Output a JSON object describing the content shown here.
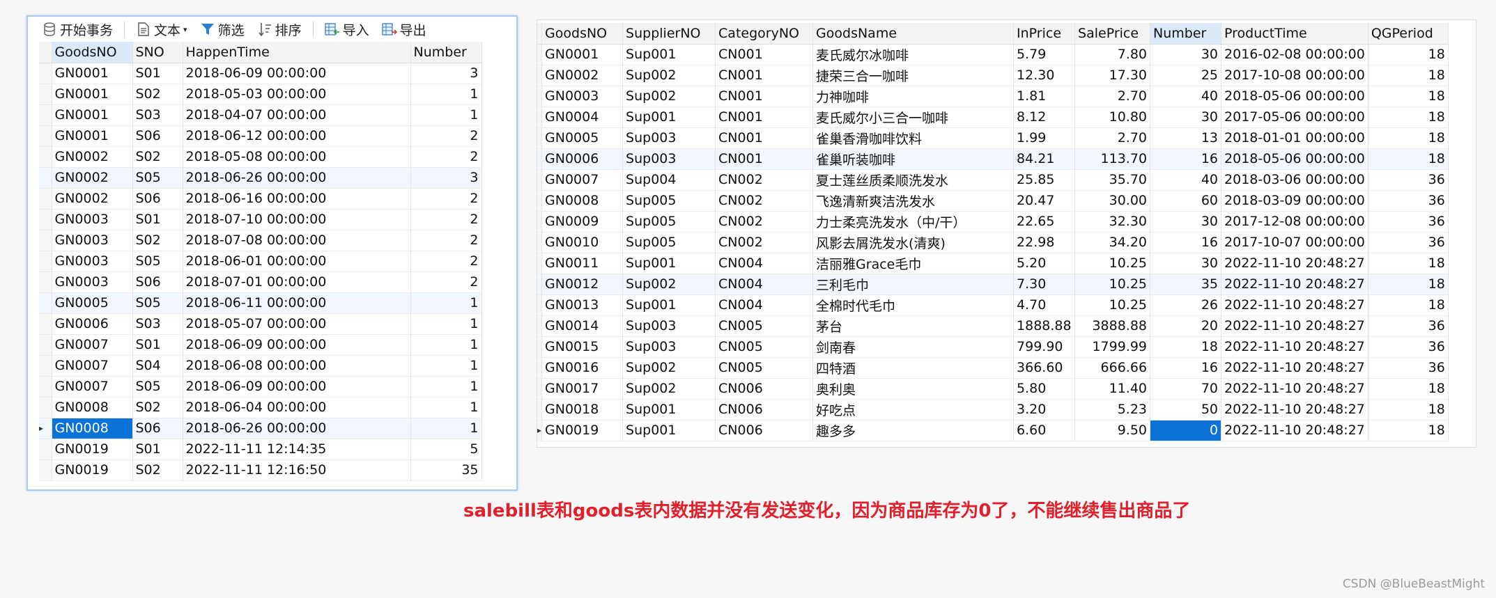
{
  "left_toolbar": {
    "begin_txn": "开始事务",
    "text": "文本",
    "filter": "筛选",
    "sort": "排序",
    "import": "导入",
    "export": "导出"
  },
  "salebill": {
    "columns": [
      "GoodsNO",
      "SNO",
      "HappenTime",
      "Number"
    ],
    "rows": [
      [
        "GN0001",
        "S01",
        "2018-06-09 00:00:00",
        "3"
      ],
      [
        "GN0001",
        "S02",
        "2018-05-03 00:00:00",
        "1"
      ],
      [
        "GN0001",
        "S03",
        "2018-04-07 00:00:00",
        "1"
      ],
      [
        "GN0001",
        "S06",
        "2018-06-12 00:00:00",
        "2"
      ],
      [
        "GN0002",
        "S02",
        "2018-05-08 00:00:00",
        "2"
      ],
      [
        "GN0002",
        "S05",
        "2018-06-26 00:00:00",
        "3"
      ],
      [
        "GN0002",
        "S06",
        "2018-06-16 00:00:00",
        "2"
      ],
      [
        "GN0003",
        "S01",
        "2018-07-10 00:00:00",
        "2"
      ],
      [
        "GN0003",
        "S02",
        "2018-07-08 00:00:00",
        "2"
      ],
      [
        "GN0003",
        "S05",
        "2018-06-01 00:00:00",
        "2"
      ],
      [
        "GN0003",
        "S06",
        "2018-07-01 00:00:00",
        "2"
      ],
      [
        "GN0005",
        "S05",
        "2018-06-11 00:00:00",
        "1"
      ],
      [
        "GN0006",
        "S03",
        "2018-05-07 00:00:00",
        "1"
      ],
      [
        "GN0007",
        "S01",
        "2018-06-09 00:00:00",
        "1"
      ],
      [
        "GN0007",
        "S04",
        "2018-06-08 00:00:00",
        "1"
      ],
      [
        "GN0007",
        "S05",
        "2018-06-09 00:00:00",
        "1"
      ],
      [
        "GN0008",
        "S02",
        "2018-06-04 00:00:00",
        "1"
      ],
      [
        "GN0008",
        "S06",
        "2018-06-26 00:00:00",
        "1"
      ],
      [
        "GN0019",
        "S01",
        "2022-11-11 12:14:35",
        "5"
      ],
      [
        "GN0019",
        "S02",
        "2022-11-11 12:16:50",
        "35"
      ]
    ]
  },
  "goods": {
    "columns": [
      "GoodsNO",
      "SupplierNO",
      "CategoryNO",
      "GoodsName",
      "InPrice",
      "SalePrice",
      "Number",
      "ProductTime",
      "QGPeriod"
    ],
    "rows": [
      [
        "GN0001",
        "Sup001",
        "CN001",
        "麦氏威尔冰咖啡",
        "5.79",
        "7.80",
        "30",
        "2016-02-08 00:00:00",
        "18"
      ],
      [
        "GN0002",
        "Sup002",
        "CN001",
        "捷荣三合一咖啡",
        "12.30",
        "17.30",
        "25",
        "2017-10-08 00:00:00",
        "18"
      ],
      [
        "GN0003",
        "Sup002",
        "CN001",
        "力神咖啡",
        "1.81",
        "2.70",
        "40",
        "2018-05-06 00:00:00",
        "18"
      ],
      [
        "GN0004",
        "Sup001",
        "CN001",
        "麦氏威尔小三合一咖啡",
        "8.12",
        "10.80",
        "30",
        "2017-05-06 00:00:00",
        "18"
      ],
      [
        "GN0005",
        "Sup003",
        "CN001",
        "雀巢香滑咖啡饮料",
        "1.99",
        "2.70",
        "13",
        "2018-01-01 00:00:00",
        "18"
      ],
      [
        "GN0006",
        "Sup003",
        "CN001",
        "雀巢听装咖啡",
        "84.21",
        "113.70",
        "16",
        "2018-05-06 00:00:00",
        "18"
      ],
      [
        "GN0007",
        "Sup004",
        "CN002",
        "夏士莲丝质柔顺洗发水",
        "25.85",
        "35.70",
        "40",
        "2018-03-06 00:00:00",
        "36"
      ],
      [
        "GN0008",
        "Sup005",
        "CN002",
        "飞逸清新爽洁洗发水",
        "20.47",
        "30.00",
        "60",
        "2018-03-09 00:00:00",
        "36"
      ],
      [
        "GN0009",
        "Sup005",
        "CN002",
        "力士柔亮洗发水（中/干）",
        "22.65",
        "32.30",
        "30",
        "2017-12-08 00:00:00",
        "36"
      ],
      [
        "GN0010",
        "Sup005",
        "CN002",
        "风影去屑洗发水(清爽)",
        "22.98",
        "34.20",
        "16",
        "2017-10-07 00:00:00",
        "36"
      ],
      [
        "GN0011",
        "Sup001",
        "CN004",
        "洁丽雅Grace毛巾",
        "5.20",
        "10.25",
        "30",
        "2022-11-10 20:48:27",
        "18"
      ],
      [
        "GN0012",
        "Sup002",
        "CN004",
        "三利毛巾",
        "7.30",
        "10.25",
        "35",
        "2022-11-10 20:48:27",
        "18"
      ],
      [
        "GN0013",
        "Sup001",
        "CN004",
        "全棉时代毛巾",
        "4.70",
        "10.25",
        "26",
        "2022-11-10 20:48:27",
        "18"
      ],
      [
        "GN0014",
        "Sup003",
        "CN005",
        "茅台",
        "1888.88",
        "3888.88",
        "20",
        "2022-11-10 20:48:27",
        "36"
      ],
      [
        "GN0015",
        "Sup003",
        "CN005",
        "剑南春",
        "799.90",
        "1799.99",
        "18",
        "2022-11-10 20:48:27",
        "36"
      ],
      [
        "GN0016",
        "Sup002",
        "CN005",
        "四特酒",
        "366.60",
        "666.66",
        "16",
        "2022-11-10 20:48:27",
        "36"
      ],
      [
        "GN0017",
        "Sup002",
        "CN006",
        "奥利奥",
        "5.80",
        "11.40",
        "70",
        "2022-11-10 20:48:27",
        "18"
      ],
      [
        "GN0018",
        "Sup001",
        "CN006",
        "好吃点",
        "3.20",
        "5.23",
        "50",
        "2022-11-10 20:48:27",
        "18"
      ],
      [
        "GN0019",
        "Sup001",
        "CN006",
        "趣多多",
        "6.60",
        "9.50",
        "0",
        "2022-11-10 20:48:27",
        "18"
      ]
    ]
  },
  "caption": "salebill表和goods表内数据并没有发送变化，因为商品库存为0了，不能继续售出商品了",
  "watermark": "CSDN @BlueBeastMight",
  "colors": {
    "selection": "#0a72d6",
    "caption": "#e0202a",
    "panel_border": "#a9c8f0"
  }
}
